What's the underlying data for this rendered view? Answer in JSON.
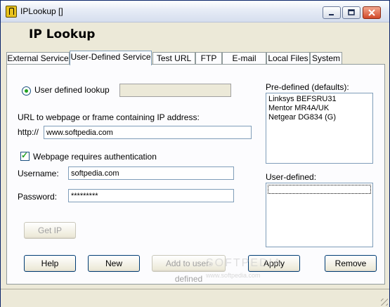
{
  "window": {
    "title": "IPLookup []"
  },
  "header": {
    "app_title": "IP Lookup"
  },
  "tabs": [
    {
      "label": "External Service"
    },
    {
      "label": "User-Defined Service",
      "active": true
    },
    {
      "label": "Test URL"
    },
    {
      "label": "FTP"
    },
    {
      "label": "E-mail"
    },
    {
      "label": "Local Files"
    },
    {
      "label": "System"
    }
  ],
  "form": {
    "radio_label": "User defined lookup",
    "lookup_value": "",
    "url_caption": "URL to webpage or frame containing IP address:",
    "url_prefix": "http://",
    "url_value": "www.softpedia.com",
    "auth_label": "Webpage requires authentication",
    "username_label": "Username:",
    "username_value": "softpedia.com",
    "password_label": "Password:",
    "password_value": "*********",
    "get_ip_label": "Get IP"
  },
  "predefined": {
    "label": "Pre-defined (defaults):",
    "items": [
      "Linksys BEFSRU31",
      "Mentor MR4A/UK",
      "Netgear DG834 (G)"
    ]
  },
  "userdefined": {
    "label": "User-defined:"
  },
  "buttons": {
    "help": "Help",
    "new": "New",
    "add": "Add to user-defined",
    "apply": "Apply",
    "remove": "Remove"
  },
  "watermark": {
    "text": "SOFTPEDIA",
    "url": "www.softpedia.com"
  },
  "colors": {
    "accent": "#21a121",
    "border": "#7f9db9"
  }
}
